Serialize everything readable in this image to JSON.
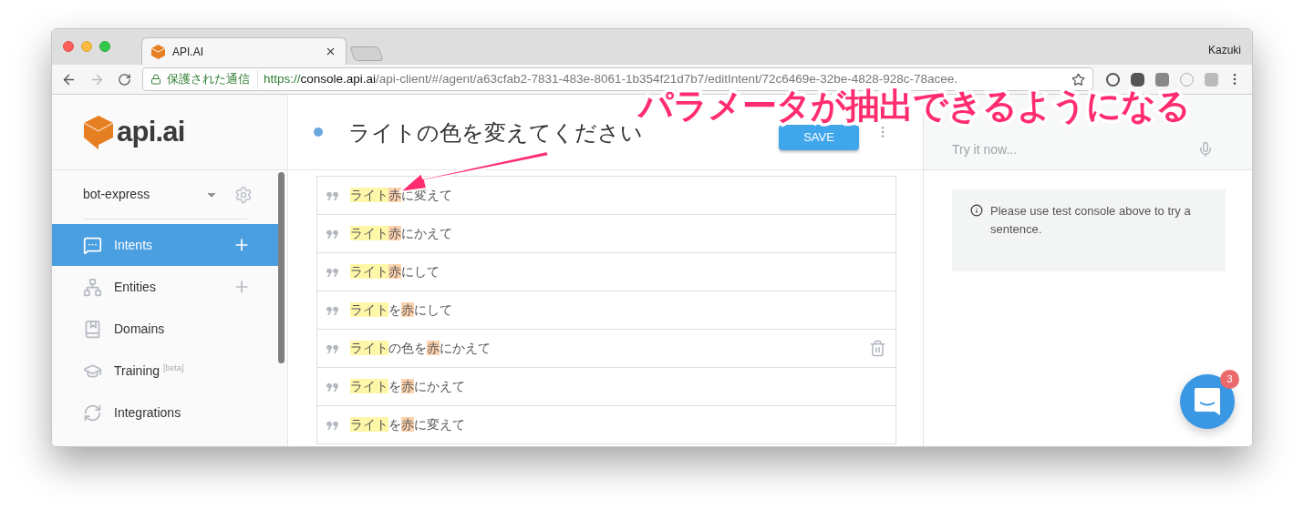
{
  "browser": {
    "tab_title": "API.AI",
    "user": "Kazuki",
    "secure_label": "保護された通信",
    "url_host": "https://console.api.ai",
    "url_path": "/api-client/#/agent/a63cfab2-7831-483e-8061-1b354f21d7b7/editIntent/72c6469e-32be-4828-928c-78acee."
  },
  "sidebar": {
    "logo": "api.ai",
    "agent": "bot-express",
    "items": [
      {
        "label": "Intents",
        "selected": true,
        "has_add": true
      },
      {
        "label": "Entities",
        "selected": false,
        "has_add": true
      },
      {
        "label": "Domains",
        "selected": false,
        "has_add": false
      },
      {
        "label": "Training $^{[beta]}$",
        "selected": false,
        "has_add": false
      },
      {
        "label": "Integrations",
        "selected": false,
        "has_add": false
      }
    ]
  },
  "intent": {
    "title": "ライトの色を変えてください",
    "save": "SAVE",
    "examples": [
      {
        "hovered": false,
        "parts": [
          {
            "text": "ライト",
            "color": "#fff7a8"
          },
          {
            "text": "赤",
            "color": "#fdd3ad"
          },
          {
            "text": "に変えて"
          }
        ]
      },
      {
        "hovered": false,
        "parts": [
          {
            "text": "ライト",
            "color": "#fff7a8"
          },
          {
            "text": "赤",
            "color": "#fdd3ad"
          },
          {
            "text": "にかえて"
          }
        ]
      },
      {
        "hovered": false,
        "parts": [
          {
            "text": "ライト",
            "color": "#fff7a8"
          },
          {
            "text": "赤",
            "color": "#fdd3ad"
          },
          {
            "text": "にして"
          }
        ]
      },
      {
        "hovered": false,
        "parts": [
          {
            "text": "ライト",
            "color": "#fff7a8"
          },
          {
            "text": "を"
          },
          {
            "text": "赤",
            "color": "#fdd3ad"
          },
          {
            "text": "にして"
          }
        ]
      },
      {
        "hovered": true,
        "parts": [
          {
            "text": "ライト",
            "color": "#fff7a8"
          },
          {
            "text": "の色を"
          },
          {
            "text": "赤",
            "color": "#fdd3ad"
          },
          {
            "text": "にかえて"
          }
        ]
      },
      {
        "hovered": false,
        "parts": [
          {
            "text": "ライト",
            "color": "#fff7a8"
          },
          {
            "text": "を"
          },
          {
            "text": "赤",
            "color": "#fdd3ad"
          },
          {
            "text": "にかえて"
          }
        ]
      },
      {
        "hovered": false,
        "parts": [
          {
            "text": "ライト",
            "color": "#fff7a8"
          },
          {
            "text": "を"
          },
          {
            "text": "赤",
            "color": "#fdd3ad"
          },
          {
            "text": "に変えて"
          }
        ]
      }
    ]
  },
  "console": {
    "placeholder": "Try it now...",
    "info": "Please use test console above to try a sentence.",
    "chat_badge": "3"
  },
  "annotation": {
    "text": "パラメータが抽出できるようになる"
  }
}
